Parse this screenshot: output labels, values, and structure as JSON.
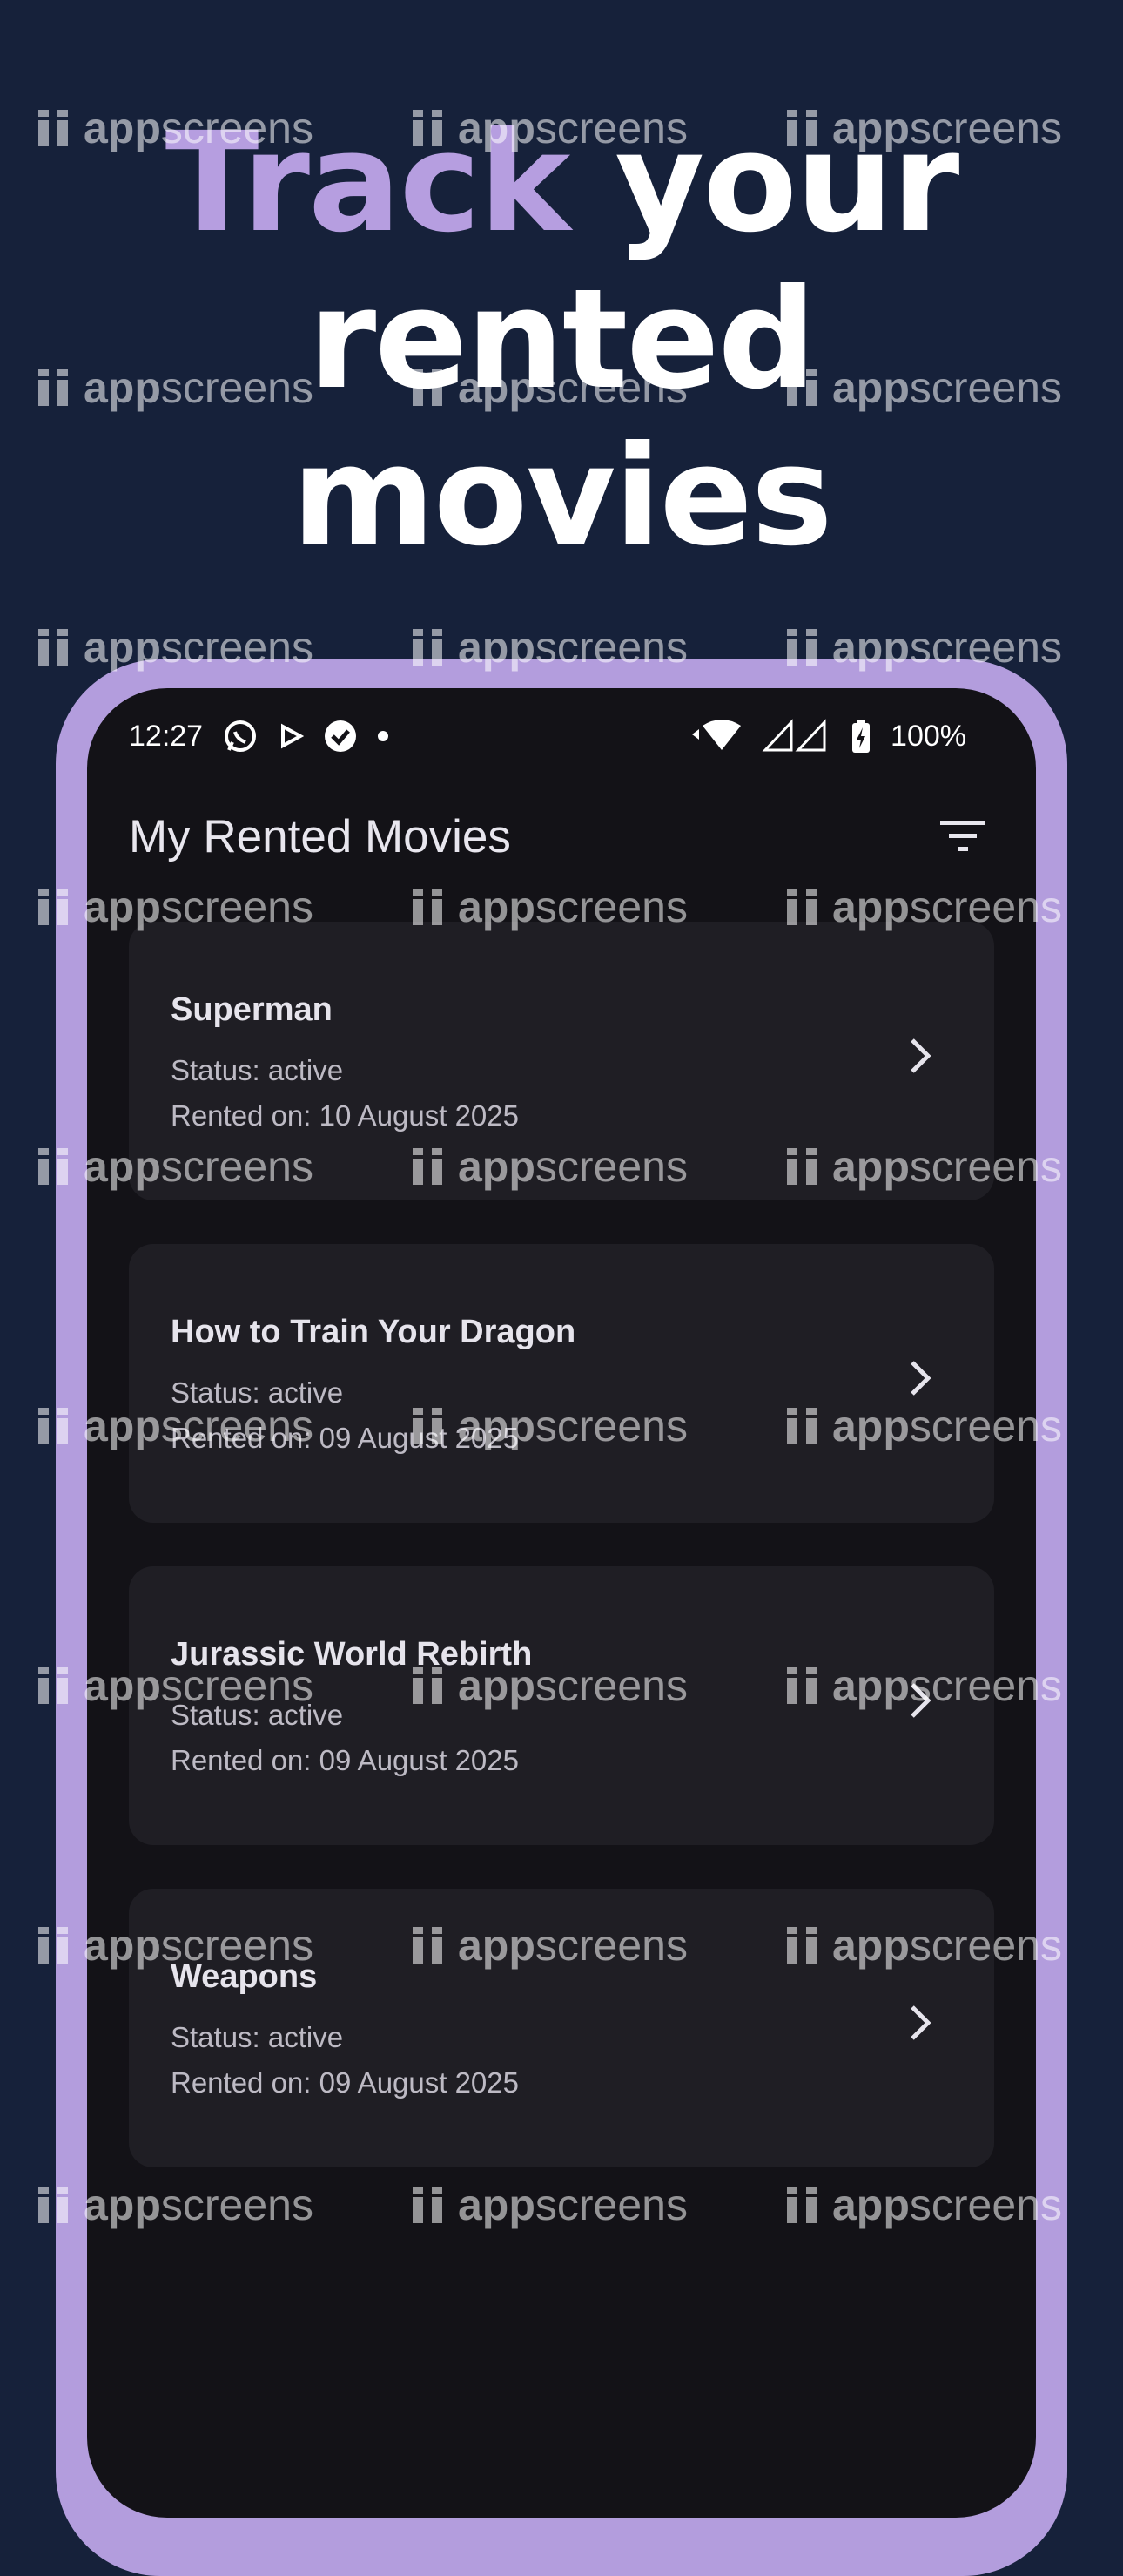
{
  "headline": {
    "accent": "Track",
    "rest_line1": " your",
    "line2": "rented",
    "line3": "movies"
  },
  "status_bar": {
    "time": "12:27",
    "battery": "100%"
  },
  "app_bar": {
    "title": "My Rented Movies"
  },
  "movies": [
    {
      "title": "Superman",
      "status": "Status: active",
      "rented": "Rented on: 10 August 2025"
    },
    {
      "title": "How to Train Your Dragon",
      "status": "Status: active",
      "rented": "Rented on: 09 August 2025"
    },
    {
      "title": "Jurassic World Rebirth",
      "status": "Status: active",
      "rented": "Rented on: 09 August 2025"
    },
    {
      "title": "Weapons",
      "status": "Status: active",
      "rented": "Rented on: 09 August 2025"
    }
  ],
  "watermark": {
    "bold": "app",
    "light": "screens"
  },
  "colors": {
    "background": "#16213a",
    "accent": "#b69ee0",
    "frame": "#b39ddd",
    "screen": "#131217",
    "card": "#1f1e24"
  },
  "icons": [
    "whatsapp-icon",
    "play-icon",
    "check-circle-icon",
    "dot-icon",
    "wifi-icon",
    "signal-icon",
    "battery-icon",
    "filter-icon",
    "chevron-right-icon"
  ]
}
